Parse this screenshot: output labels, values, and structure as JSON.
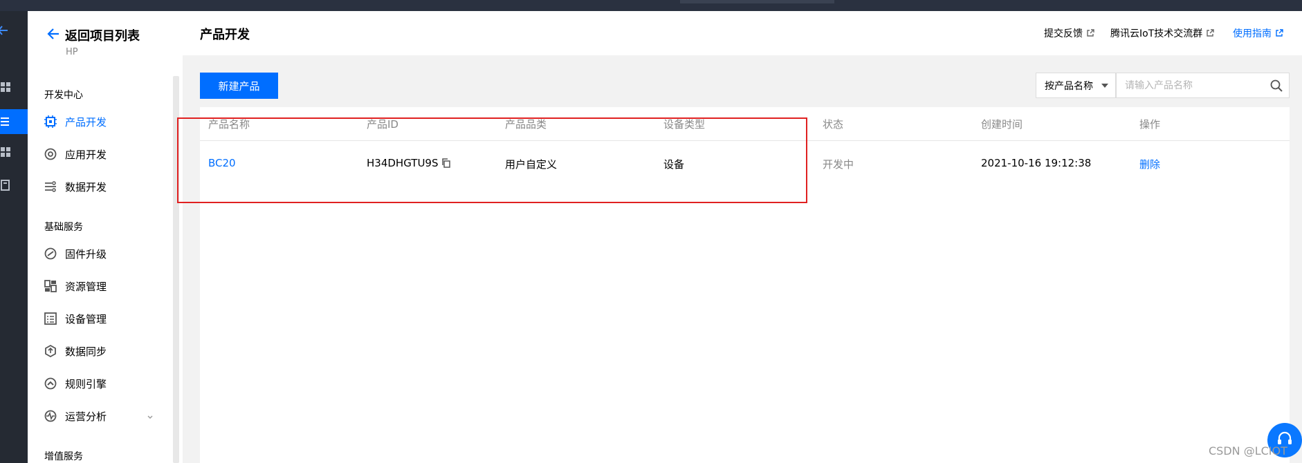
{
  "rail": {
    "items": [
      {
        "icon": "arrow-left-icon"
      },
      {
        "icon": "grid-icon"
      },
      {
        "icon": "list-icon",
        "active": true
      },
      {
        "icon": "grid-icon"
      },
      {
        "icon": "document-icon"
      }
    ]
  },
  "sidebar": {
    "back_label": "返回项目列表",
    "project_name": "HP",
    "section_dev": "开发中心",
    "dev_items": [
      {
        "label": "产品开发",
        "icon": "chip-icon",
        "active": true
      },
      {
        "label": "应用开发",
        "icon": "app-gear-icon"
      },
      {
        "label": "数据开发",
        "icon": "data-flow-icon"
      }
    ],
    "section_basic": "基础服务",
    "basic_items": [
      {
        "label": "固件升级",
        "icon": "firmware-icon"
      },
      {
        "label": "资源管理",
        "icon": "resource-icon"
      },
      {
        "label": "设备管理",
        "icon": "device-list-icon"
      },
      {
        "label": "数据同步",
        "icon": "sync-icon"
      },
      {
        "label": "规则引擎",
        "icon": "rule-engine-icon"
      },
      {
        "label": "运营分析",
        "icon": "analytics-icon"
      }
    ],
    "section_value": "增值服务"
  },
  "header": {
    "title": "产品开发",
    "links": [
      {
        "label": "提交反馈",
        "color": "#000000"
      },
      {
        "label": "腾讯云IoT技术交流群",
        "color": "#000000"
      },
      {
        "label": "使用指南",
        "color": "#006eff"
      }
    ]
  },
  "toolbar": {
    "new_button": "新建产品",
    "filter_selected": "按产品名称",
    "search_placeholder": "请输入产品名称"
  },
  "table": {
    "columns": [
      "产品名称",
      "产品ID",
      "产品品类",
      "设备类型",
      "状态",
      "创建时间",
      "操作"
    ],
    "rows": [
      {
        "name": "BC20",
        "id": "H34DHGTU9S",
        "category": "用户自定义",
        "device_type": "设备",
        "status": "开发中",
        "created": "2021-10-16 19:12:38",
        "action": "删除"
      }
    ]
  },
  "watermark": "CSDN @LCIOT",
  "colors": {
    "accent": "#006eff",
    "highlight": "#e02020",
    "rail": "#252a33"
  }
}
